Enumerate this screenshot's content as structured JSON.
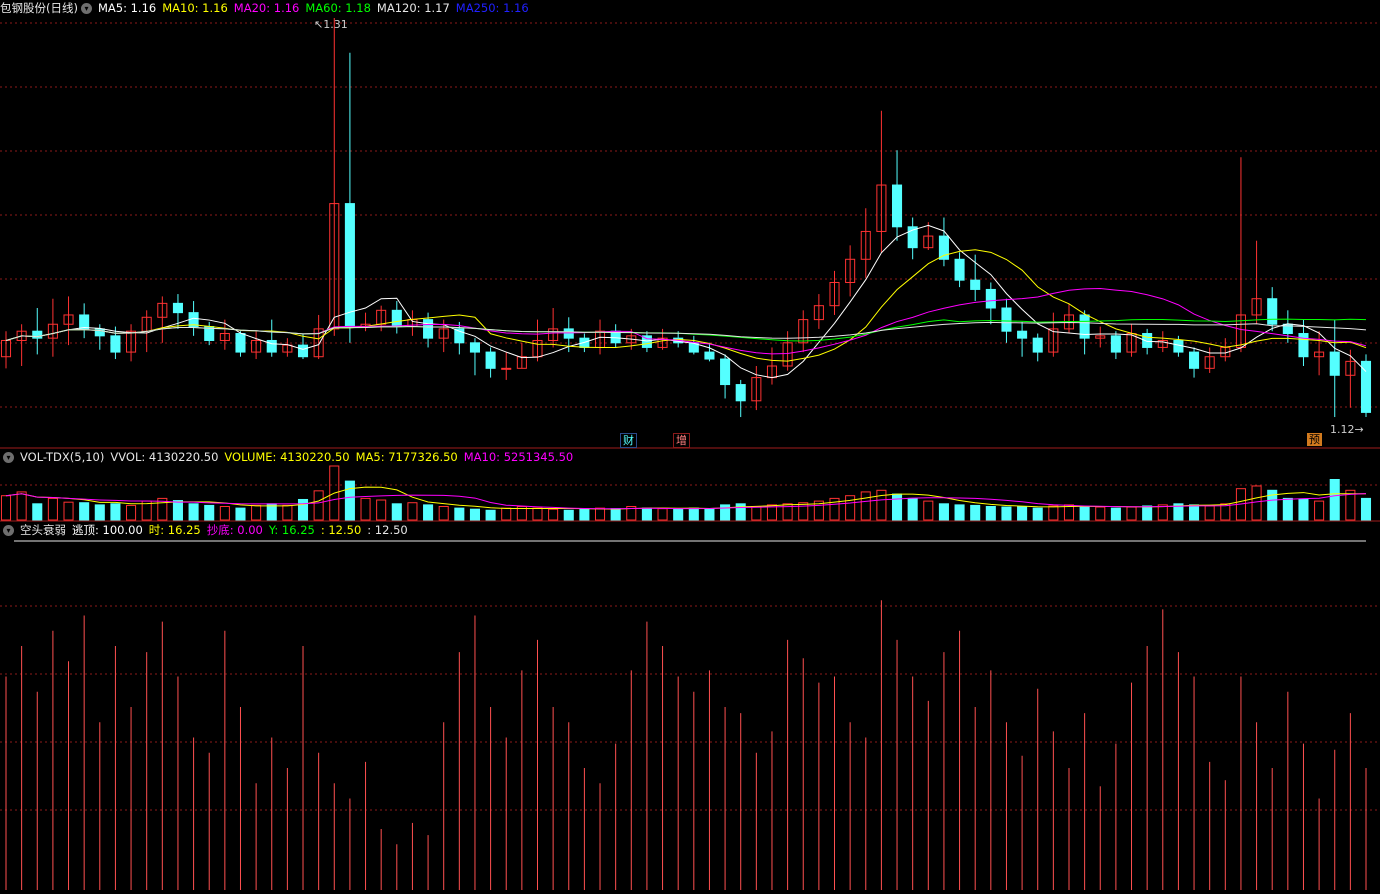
{
  "main_legend": {
    "title": "包钢股份(日线)",
    "items": [
      {
        "label": "MA5: 1.16",
        "color": "#ffffff"
      },
      {
        "label": "MA10: 1.16",
        "color": "#ffff00"
      },
      {
        "label": "MA20: 1.16",
        "color": "#ff00ff"
      },
      {
        "label": "MA60: 1.18",
        "color": "#00ff00"
      },
      {
        "label": "MA120: 1.17",
        "color": "#e6e6e6"
      },
      {
        "label": "MA250: 1.16",
        "color": "#2020ff"
      }
    ]
  },
  "vol_legend": {
    "title": "VOL-TDX(5,10)",
    "items": [
      {
        "label": "VVOL: 4130220.50",
        "color": "#e6e6e6"
      },
      {
        "label": "VOLUME: 4130220.50",
        "color": "#ffff00"
      },
      {
        "label": "MA5: 7177326.50",
        "color": "#ffff00"
      },
      {
        "label": "MA10: 5251345.50",
        "color": "#ff00ff"
      }
    ]
  },
  "ind_legend": {
    "title": "空头衰弱",
    "items": [
      {
        "label": "逃顶: 100.00",
        "color": "#ffffff"
      },
      {
        "label": "时: 16.25",
        "color": "#ffff00"
      },
      {
        "label": "抄底: 0.00",
        "color": "#ff00ff"
      },
      {
        "label": "Y: 16.25",
        "color": "#00ff00"
      },
      {
        "label": ": 12.50",
        "color": "#ffff00"
      },
      {
        "label": ": 12.50",
        "color": "#e6e6e6"
      }
    ]
  },
  "annotations": {
    "high": "1.31",
    "low": "1.12",
    "marker_cai": "财",
    "marker_zeng": "增",
    "marker_yu": "预"
  },
  "colors": {
    "up": "#ff3232",
    "down": "#54ffff",
    "grid": "#8b1a1a",
    "separator": "#a01c1c"
  },
  "chart_data": {
    "type": "candlestick",
    "price_axis": {
      "high": 1.31,
      "low": 1.12
    },
    "candles": [
      [
        1.164,
        1.171,
        1.175,
        1.159
      ],
      [
        1.171,
        1.175,
        1.178,
        1.16
      ],
      [
        1.175,
        1.172,
        1.185,
        1.165
      ],
      [
        1.172,
        1.178,
        1.189,
        1.164
      ],
      [
        1.178,
        1.182,
        1.19,
        1.169
      ],
      [
        1.182,
        1.176,
        1.187,
        1.172
      ],
      [
        1.176,
        1.173,
        1.178,
        1.167
      ],
      [
        1.173,
        1.166,
        1.177,
        1.163
      ],
      [
        1.166,
        1.175,
        1.178,
        1.162
      ],
      [
        1.175,
        1.181,
        1.184,
        1.166
      ],
      [
        1.181,
        1.187,
        1.19,
        1.17
      ],
      [
        1.187,
        1.183,
        1.191,
        1.176
      ],
      [
        1.183,
        1.177,
        1.188,
        1.173
      ],
      [
        1.177,
        1.171,
        1.179,
        1.169
      ],
      [
        1.171,
        1.174,
        1.18,
        1.167
      ],
      [
        1.174,
        1.166,
        1.175,
        1.164
      ],
      [
        1.166,
        1.171,
        1.175,
        1.163
      ],
      [
        1.171,
        1.166,
        1.18,
        1.164
      ],
      [
        1.166,
        1.169,
        1.172,
        1.164
      ],
      [
        1.169,
        1.164,
        1.174,
        1.163
      ],
      [
        1.164,
        1.176,
        1.182,
        1.163
      ],
      [
        1.176,
        1.23,
        1.31,
        1.173
      ],
      [
        1.23,
        1.177,
        1.295,
        1.17
      ],
      [
        1.177,
        1.178,
        1.183,
        1.175
      ],
      [
        1.178,
        1.184,
        1.186,
        1.175
      ],
      [
        1.184,
        1.177,
        1.188,
        1.174
      ],
      [
        1.177,
        1.18,
        1.184,
        1.173
      ],
      [
        1.18,
        1.172,
        1.183,
        1.168
      ],
      [
        1.172,
        1.176,
        1.18,
        1.166
      ],
      [
        1.176,
        1.17,
        1.179,
        1.165
      ],
      [
        1.17,
        1.166,
        1.172,
        1.156
      ],
      [
        1.166,
        1.159,
        1.168,
        1.155
      ],
      [
        1.159,
        1.159,
        1.166,
        1.154
      ],
      [
        1.159,
        1.164,
        1.17,
        1.159
      ],
      [
        1.164,
        1.171,
        1.18,
        1.162
      ],
      [
        1.171,
        1.176,
        1.185,
        1.168
      ],
      [
        1.176,
        1.172,
        1.181,
        1.166
      ],
      [
        1.172,
        1.168,
        1.174,
        1.166
      ],
      [
        1.168,
        1.175,
        1.18,
        1.165
      ],
      [
        1.175,
        1.17,
        1.178,
        1.168
      ],
      [
        1.17,
        1.173,
        1.176,
        1.167
      ],
      [
        1.173,
        1.168,
        1.175,
        1.166
      ],
      [
        1.168,
        1.172,
        1.176,
        1.167
      ],
      [
        1.172,
        1.17,
        1.175,
        1.168
      ],
      [
        1.17,
        1.166,
        1.173,
        1.165
      ],
      [
        1.166,
        1.163,
        1.17,
        1.162
      ],
      [
        1.163,
        1.152,
        1.165,
        1.146
      ],
      [
        1.152,
        1.145,
        1.154,
        1.138
      ],
      [
        1.145,
        1.155,
        1.16,
        1.141
      ],
      [
        1.155,
        1.16,
        1.168,
        1.152
      ],
      [
        1.16,
        1.17,
        1.175,
        1.158
      ],
      [
        1.17,
        1.18,
        1.184,
        1.166
      ],
      [
        1.18,
        1.186,
        1.191,
        1.176
      ],
      [
        1.186,
        1.196,
        1.201,
        1.182
      ],
      [
        1.196,
        1.206,
        1.212,
        1.19
      ],
      [
        1.206,
        1.218,
        1.228,
        1.198
      ],
      [
        1.218,
        1.238,
        1.27,
        1.209
      ],
      [
        1.238,
        1.22,
        1.253,
        1.214
      ],
      [
        1.22,
        1.211,
        1.224,
        1.206
      ],
      [
        1.211,
        1.216,
        1.222,
        1.21
      ],
      [
        1.216,
        1.206,
        1.224,
        1.203
      ],
      [
        1.206,
        1.197,
        1.209,
        1.194
      ],
      [
        1.197,
        1.193,
        1.208,
        1.188
      ],
      [
        1.193,
        1.185,
        1.196,
        1.178
      ],
      [
        1.185,
        1.175,
        1.189,
        1.17
      ],
      [
        1.175,
        1.172,
        1.179,
        1.164
      ],
      [
        1.172,
        1.166,
        1.174,
        1.162
      ],
      [
        1.166,
        1.176,
        1.183,
        1.164
      ],
      [
        1.176,
        1.182,
        1.187,
        1.174
      ],
      [
        1.182,
        1.172,
        1.184,
        1.165
      ],
      [
        1.172,
        1.173,
        1.177,
        1.168
      ],
      [
        1.173,
        1.166,
        1.175,
        1.163
      ],
      [
        1.166,
        1.174,
        1.178,
        1.164
      ],
      [
        1.174,
        1.168,
        1.176,
        1.165
      ],
      [
        1.168,
        1.171,
        1.175,
        1.166
      ],
      [
        1.171,
        1.166,
        1.173,
        1.164
      ],
      [
        1.166,
        1.159,
        1.168,
        1.155
      ],
      [
        1.159,
        1.164,
        1.168,
        1.157
      ],
      [
        1.164,
        1.168,
        1.172,
        1.162
      ],
      [
        1.168,
        1.182,
        1.25,
        1.166
      ],
      [
        1.182,
        1.189,
        1.214,
        1.178
      ],
      [
        1.189,
        1.178,
        1.194,
        1.175
      ],
      [
        1.178,
        1.174,
        1.184,
        1.17
      ],
      [
        1.174,
        1.164,
        1.18,
        1.16
      ],
      [
        1.164,
        1.166,
        1.175,
        1.156
      ],
      [
        1.166,
        1.156,
        1.18,
        1.138
      ],
      [
        1.156,
        1.162,
        1.167,
        1.142
      ],
      [
        1.162,
        1.14,
        1.165,
        1.138
      ]
    ],
    "volume_relative": [
      0.45,
      0.52,
      0.3,
      0.4,
      0.33,
      0.32,
      0.28,
      0.3,
      0.27,
      0.35,
      0.4,
      0.36,
      0.3,
      0.27,
      0.25,
      0.22,
      0.27,
      0.3,
      0.27,
      0.38,
      0.54,
      1.0,
      0.72,
      0.4,
      0.37,
      0.3,
      0.32,
      0.28,
      0.25,
      0.22,
      0.2,
      0.18,
      0.22,
      0.25,
      0.22,
      0.2,
      0.18,
      0.2,
      0.22,
      0.21,
      0.25,
      0.22,
      0.21,
      0.2,
      0.22,
      0.21,
      0.28,
      0.3,
      0.25,
      0.28,
      0.3,
      0.32,
      0.35,
      0.4,
      0.45,
      0.52,
      0.55,
      0.48,
      0.4,
      0.35,
      0.3,
      0.28,
      0.27,
      0.25,
      0.24,
      0.25,
      0.22,
      0.26,
      0.28,
      0.25,
      0.24,
      0.22,
      0.24,
      0.26,
      0.28,
      0.3,
      0.28,
      0.26,
      0.3,
      0.58,
      0.63,
      0.55,
      0.4,
      0.38,
      0.35,
      0.75,
      0.55,
      0.4
    ],
    "indicator_relative": [
      0.7,
      0.8,
      0.65,
      0.85,
      0.75,
      0.9,
      0.55,
      0.8,
      0.6,
      0.78,
      0.88,
      0.7,
      0.5,
      0.45,
      0.85,
      0.6,
      0.35,
      0.5,
      0.4,
      0.8,
      0.45,
      0.35,
      0.3,
      0.42,
      0.2,
      0.15,
      0.22,
      0.18,
      0.55,
      0.78,
      0.9,
      0.6,
      0.5,
      0.72,
      0.82,
      0.6,
      0.55,
      0.4,
      0.35,
      0.48,
      0.72,
      0.88,
      0.8,
      0.7,
      0.65,
      0.72,
      0.6,
      0.58,
      0.45,
      0.52,
      0.82,
      0.76,
      0.68,
      0.7,
      0.55,
      0.5,
      0.95,
      0.82,
      0.7,
      0.62,
      0.78,
      0.85,
      0.6,
      0.72,
      0.55,
      0.44,
      0.66,
      0.52,
      0.4,
      0.58,
      0.34,
      0.48,
      0.68,
      0.8,
      0.92,
      0.78,
      0.7,
      0.42,
      0.36,
      0.7,
      0.55,
      0.4,
      0.65,
      0.48,
      0.3,
      0.46,
      0.58,
      0.4
    ]
  }
}
